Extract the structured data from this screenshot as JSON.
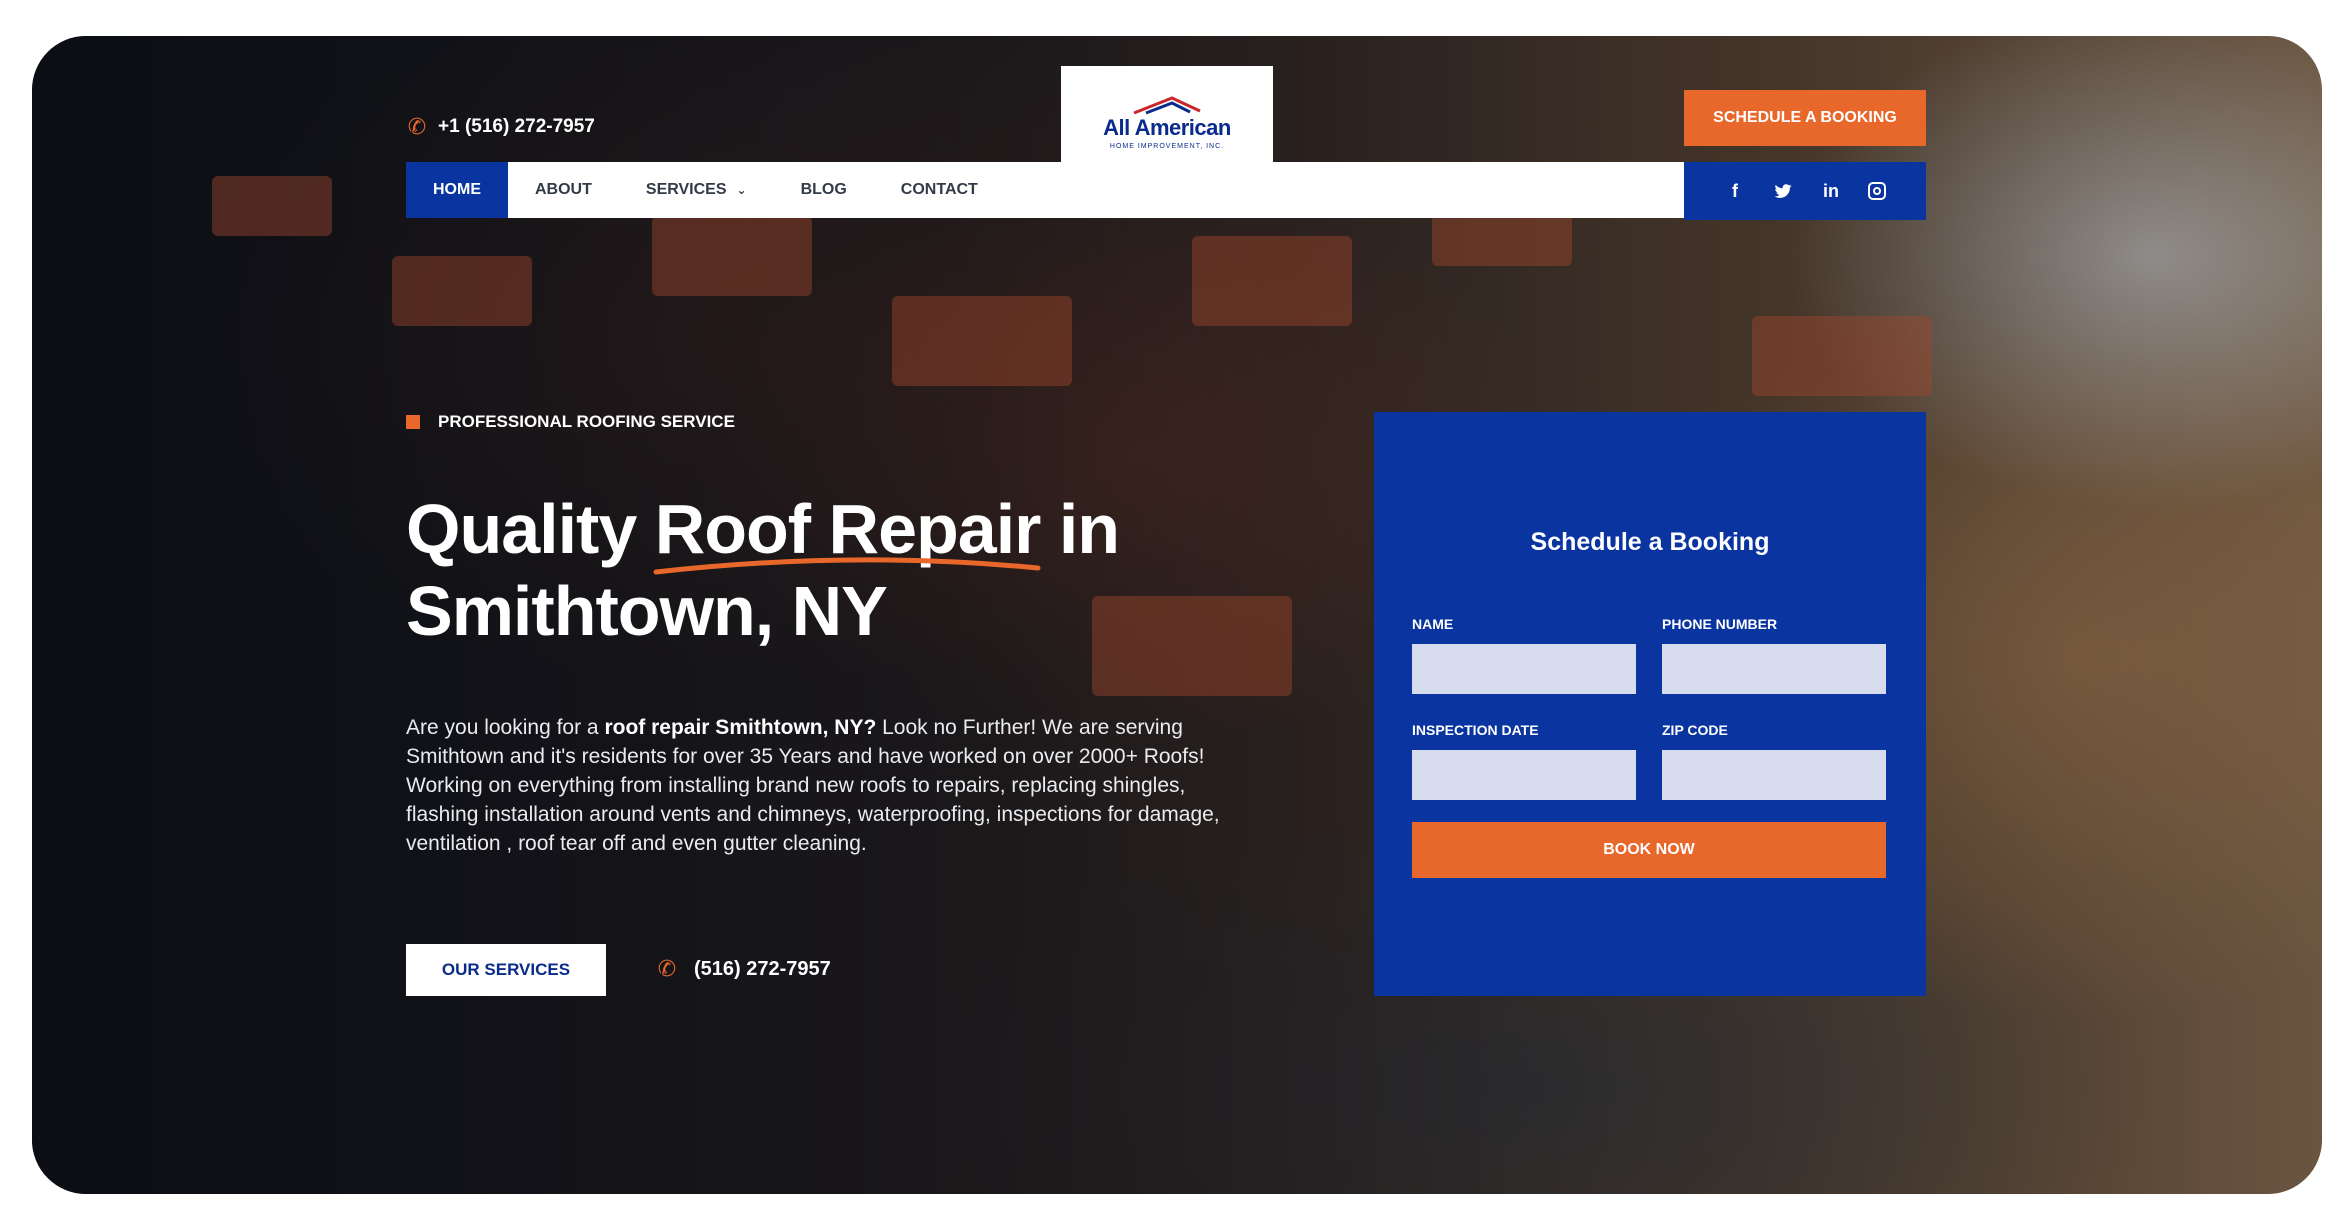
{
  "header": {
    "phone": "+1 (516) 272-7957",
    "logo": {
      "brand": "All American",
      "tagline": "HOME IMPROVEMENT, INC."
    },
    "schedule_label": "SCHEDULE A BOOKING"
  },
  "nav": {
    "items": [
      {
        "label": "HOME",
        "active": true
      },
      {
        "label": "ABOUT"
      },
      {
        "label": "SERVICES",
        "has_dropdown": true
      },
      {
        "label": "BLOG"
      },
      {
        "label": "CONTACT"
      }
    ]
  },
  "social": {
    "icons": [
      "facebook-icon",
      "twitter-icon",
      "linkedin-icon",
      "instagram-icon"
    ],
    "facebook_glyph": "f",
    "linkedin_glyph": "in"
  },
  "hero": {
    "eyebrow": "PROFESSIONAL ROOFING SERVICE",
    "headline_line1": "Quality Roof Repair in",
    "headline_line2": "Smithtown, NY",
    "description_lead": "Are you looking for a ",
    "description_bold": "roof repair Smithtown, NY?",
    "description_rest": " Look no Further! We are serving Smithtown and it's residents for over 35 Years and have worked on over 2000+ Roofs! Working on everything from installing brand new roofs to repairs, replacing shingles, flashing installation around vents and chimneys, waterproofing, inspections for damage, ventilation , roof tear off and even gutter cleaning.",
    "services_button": "OUR SERVICES",
    "cta_phone": "(516) 272-7957"
  },
  "booking": {
    "title": "Schedule a Booking",
    "fields": {
      "name": "NAME",
      "phone": "PHONE NUMBER",
      "date": "INSPECTION DATE",
      "zip": "ZIP CODE"
    },
    "submit": "BOOK NOW"
  },
  "colors": {
    "accent_orange": "#e8672a",
    "brand_blue": "#0a35a0",
    "input_bg": "#d6dbed"
  }
}
